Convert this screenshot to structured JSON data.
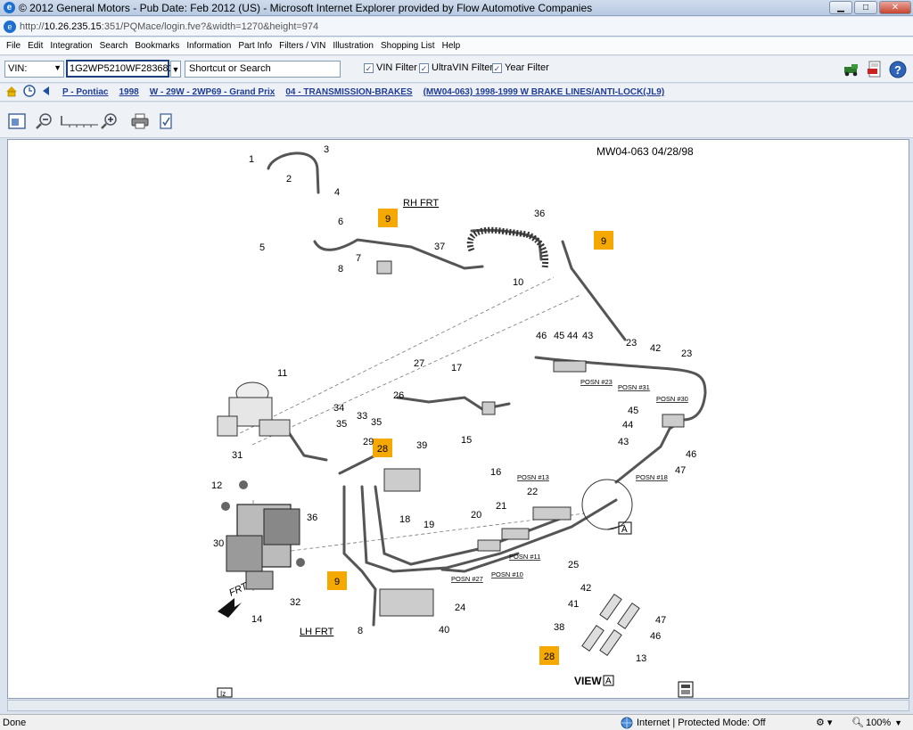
{
  "window": {
    "title": "© 2012 General Motors - Pub Date: Feb 2012 (US) - Microsoft Internet Explorer provided by Flow Automotive Companies",
    "url_prefix": "http://",
    "url_host": "10.26.235.15",
    "url_rest": ":351/PQMace/login.fve?&width=1270&height=974"
  },
  "menu": [
    "File",
    "Edit",
    "Integration",
    "Search",
    "Bookmarks",
    "Information",
    "Part Info",
    "Filters / VIN",
    "Illustration",
    "Shopping List",
    "Help"
  ],
  "toolbar": {
    "vin_label": "VIN:",
    "vin_value": "1G2WP5210WF283681",
    "search_placeholder": "Shortcut or Search",
    "filters": [
      {
        "label": "VIN Filter",
        "checked": true
      },
      {
        "label": "UltraVIN Filter",
        "checked": true
      },
      {
        "label": "Year Filter",
        "checked": true
      }
    ]
  },
  "breadcrumb": [
    "P - Pontiac",
    "1998",
    "W - 29W - 2WP69 - Grand Prix",
    "04 - TRANSMISSION-BRAKES",
    "(MW04-063) 1998-1999 W BRAKE LINES/ANTI-LOCK(JL9)"
  ],
  "illustration": {
    "code": "MW04-063  04/28/98",
    "labels": {
      "rh_frt": "RH FRT",
      "lh_frt": "LH FRT",
      "frt": "FRT",
      "view": "VIEW",
      "view_letter": "A",
      "iz": "Iz"
    },
    "highlight_color": "#f5a800",
    "highlights": [
      "9",
      "9",
      "28",
      "9",
      "28"
    ],
    "posn_labels": [
      "POSN #23",
      "POSN #31",
      "POSN #30",
      "POSN #18",
      "POSN #13",
      "POSN #11",
      "POSN #27",
      "POSN #10"
    ],
    "callouts": [
      "1",
      "2",
      "3",
      "4",
      "5",
      "6",
      "7",
      "8",
      "10",
      "37",
      "36",
      "11",
      "17",
      "27",
      "26",
      "15",
      "16",
      "46",
      "45",
      "44",
      "43",
      "23",
      "42",
      "23",
      "45",
      "44",
      "43",
      "46",
      "47",
      "34",
      "35",
      "33",
      "35",
      "29",
      "39",
      "31",
      "12",
      "30",
      "36",
      "18",
      "19",
      "20",
      "21",
      "22",
      "25",
      "24",
      "14",
      "32",
      "8",
      "40",
      "42",
      "41",
      "47",
      "46",
      "38",
      "13"
    ]
  },
  "status": {
    "left": "Done",
    "zone": "Internet | Protected Mode: Off",
    "zoom": "100%"
  }
}
